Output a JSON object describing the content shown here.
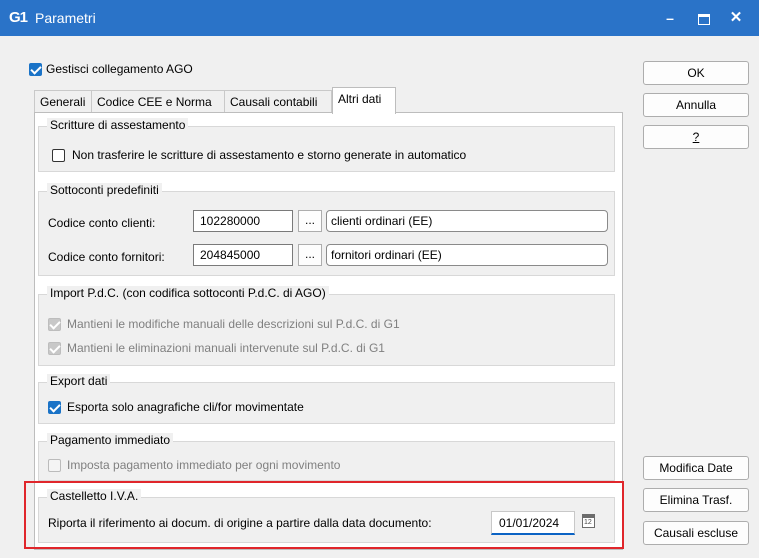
{
  "window": {
    "logo": "G1",
    "title": "Parametri",
    "min_glyph": "–",
    "close_glyph": "✕"
  },
  "top_checkbox": {
    "label": "Gestisci collegamento AGO",
    "checked": true
  },
  "tabs": [
    {
      "label": "Generali"
    },
    {
      "label": "Codice CEE e Norma"
    },
    {
      "label": "Causali contabili"
    },
    {
      "label": "Altri dati",
      "active": true
    }
  ],
  "groups": {
    "assestamento": {
      "title": "Scritture di assestamento",
      "checkbox_label": "Non trasferire le scritture di assestamento e storno generate in automatico"
    },
    "sottoconti": {
      "title": "Sottoconti predefiniti",
      "clienti_label": "Codice conto clienti:",
      "clienti_code": "102280000",
      "clienti_desc": "clienti ordinari (EE)",
      "fornitori_label": "Codice conto fornitori:",
      "fornitori_code": "204845000",
      "fornitori_desc": "fornitori ordinari (EE)",
      "lookup_label": "..."
    },
    "import": {
      "title": "Import P.d.C. (con codifica sottoconti P.d.C. di AGO)",
      "opt1": "Mantieni le modifiche manuali delle descrizioni sul P.d.C. di G1",
      "opt2": "Mantieni le eliminazioni manuali intervenute sul P.d.C. di G1"
    },
    "export": {
      "title": "Export dati",
      "opt1": "Esporta solo anagrafiche cli/for movimentate"
    },
    "pagamento": {
      "title": "Pagamento immediato",
      "opt1": "Imposta pagamento immediato per ogni movimento"
    },
    "castelletto": {
      "title": "Castelletto I.V.A.",
      "label": "Riporta il riferimento ai docum. di origine a partire dalla data documento:",
      "date": "01/01/2024"
    }
  },
  "buttons": {
    "ok": "OK",
    "annulla": "Annulla",
    "help": "?",
    "modifica_date": "Modifica Date",
    "elimina_trasf": "Elimina Trasf.",
    "causali_escluse": "Causali escluse"
  },
  "colors": {
    "titlebar": "#2a73c8",
    "checkbox_accent": "#1a73c7",
    "highlight": "#e0262b"
  }
}
